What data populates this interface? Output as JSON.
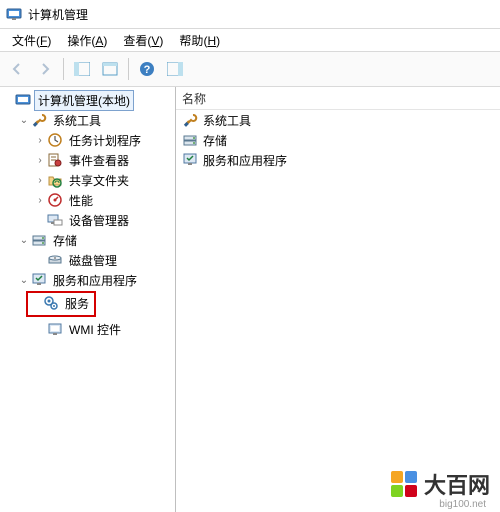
{
  "window": {
    "title": "计算机管理"
  },
  "menus": {
    "file": {
      "label": "文件",
      "hotkey": "F"
    },
    "action": {
      "label": "操作",
      "hotkey": "A"
    },
    "view": {
      "label": "查看",
      "hotkey": "V"
    },
    "help": {
      "label": "帮助",
      "hotkey": "H"
    }
  },
  "tree": {
    "root": "计算机管理(本地)",
    "system_tools": "系统工具",
    "task_scheduler": "任务计划程序",
    "event_viewer": "事件查看器",
    "shared_folders": "共享文件夹",
    "performance": "性能",
    "device_manager": "设备管理器",
    "storage": "存储",
    "disk_management": "磁盘管理",
    "services_apps": "服务和应用程序",
    "services": "服务",
    "wmi": "WMI 控件"
  },
  "list": {
    "header_name": "名称",
    "items": {
      "system_tools": "系统工具",
      "storage": "存储",
      "services_apps": "服务和应用程序"
    }
  },
  "watermark": {
    "text": "大百网",
    "sub": "big100.net"
  }
}
